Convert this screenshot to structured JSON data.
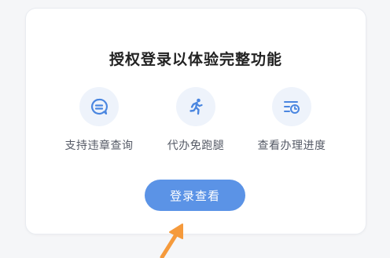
{
  "card": {
    "title": "授权登录以体验完整功能",
    "features": [
      {
        "label": "支持违章查询",
        "icon": "chat-search-icon"
      },
      {
        "label": "代办免跑腿",
        "icon": "running-person-icon"
      },
      {
        "label": "查看办理进度",
        "icon": "list-clock-icon"
      }
    ],
    "login_button": "登录查看"
  },
  "colors": {
    "accent": "#5b93e6",
    "icon": "#4a86e0",
    "icon_bg": "#eef3fb",
    "arrow": "#f59a3c"
  }
}
